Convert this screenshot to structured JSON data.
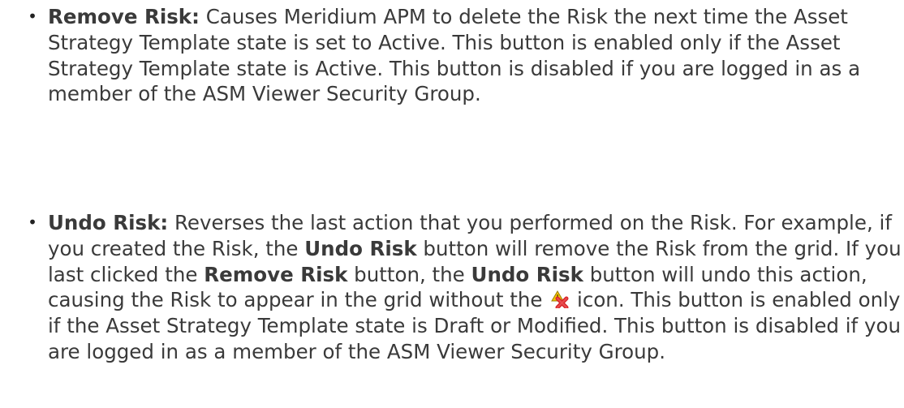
{
  "bullets": [
    {
      "symbol": "•",
      "term": "Remove Risk:",
      "text": " Causes Meridium APM to delete the Risk the next time the Asset Strategy Template state is set to Active. This button is enabled only if the Asset Strategy Template state is Active. This button is disabled if you are logged in as a member of the ASM Viewer Security Group."
    },
    {
      "symbol": "•",
      "term": "Undo Risk:",
      "segments": [
        " Reverses the last action that you performed on the Risk. For example, if you created the Risk, the ",
        "Undo Risk",
        " button will remove the Risk from the grid. If you last clicked the ",
        "Remove Risk",
        " button, the ",
        "Undo Risk",
        " button will undo this action, causing the Risk to appear in the grid without the ",
        " icon. This button is enabled only if the Asset Strategy Template state is Draft or Modified. This button is disabled if you are logged in as a member of the ASM Viewer Security Group."
      ],
      "inline_icon": "remove-risk-icon"
    }
  ],
  "colors": {
    "text": "#3a3a3a",
    "icon_red": "#d8262a",
    "icon_yellow": "#f5c400"
  }
}
